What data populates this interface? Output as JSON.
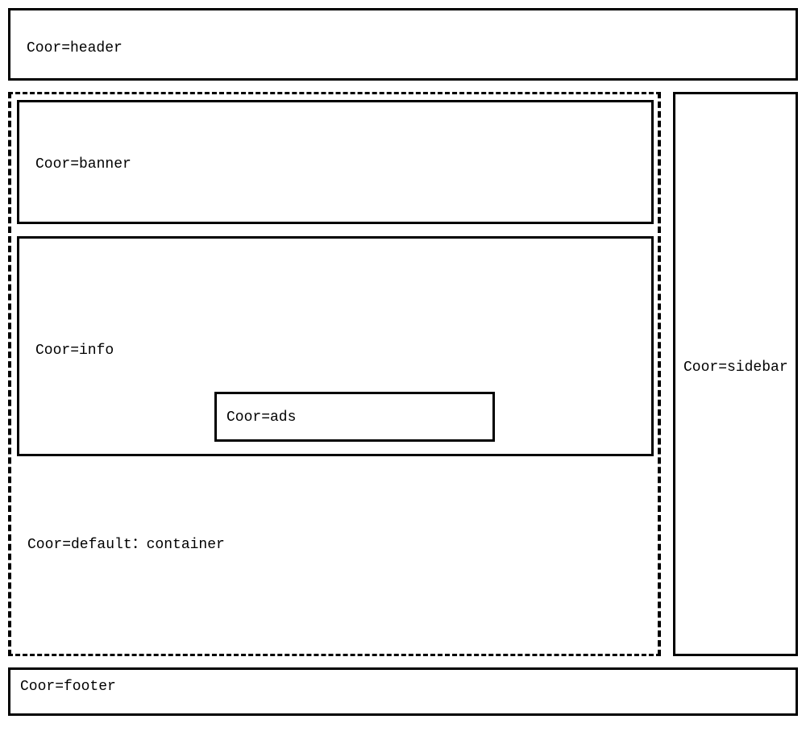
{
  "header": {
    "label": "Coor=header"
  },
  "container": {
    "label": "Coor=default：container"
  },
  "banner": {
    "label": "Coor=banner"
  },
  "info": {
    "label": "Coor=info"
  },
  "ads": {
    "label": "Coor=ads"
  },
  "sidebar": {
    "label": "Coor=sidebar"
  },
  "footer": {
    "label": "Coor=footer"
  }
}
